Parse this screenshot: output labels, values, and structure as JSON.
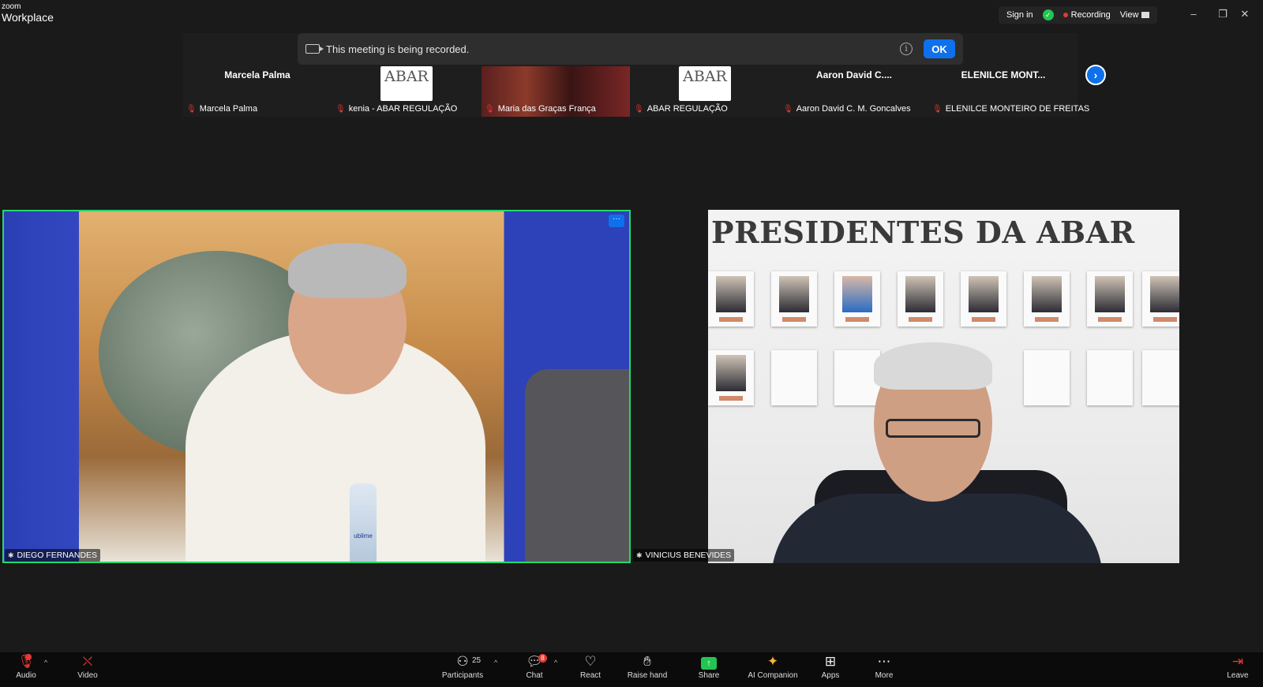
{
  "app": {
    "logo_line1": "zoom",
    "logo_line2": "Workplace"
  },
  "titlebar": {
    "sign_in": "Sign in",
    "recording": "Recording",
    "view": "View"
  },
  "banner": {
    "message": "This meeting is being recorded.",
    "ok": "OK"
  },
  "filmstrip": {
    "tiles": [
      {
        "display_name": "Marcela Palma",
        "label": "Marcela Palma"
      },
      {
        "logo_text": "ABAR",
        "label": "kenia - ABAR REGULAÇÃO"
      },
      {
        "label": "Maria das Graças França"
      },
      {
        "logo_text": "ABAR",
        "label": "ABAR REGULAÇÃO"
      },
      {
        "display_name": "Aaron David C....",
        "label": "Aaron David C. M. Goncalves"
      },
      {
        "display_name": "ELENILCE MONT...",
        "label": "ELENILCE MONTEIRO DE FREITAS"
      }
    ]
  },
  "videos": {
    "speaker": {
      "label": "DIEGO FERNANDES",
      "bottle_text": "ublime"
    },
    "guest": {
      "label": "VINICIUS BENEVIDES",
      "wall_text": "PRESIDENTES DA ABAR"
    }
  },
  "toolbar": {
    "audio": "Audio",
    "video": "Video",
    "participants": "Participants",
    "participants_count": "25",
    "chat": "Chat",
    "chat_badge": "8",
    "react": "React",
    "raise_hand": "Raise hand",
    "share": "Share",
    "ai_companion": "AI Companion",
    "apps": "Apps",
    "more": "More",
    "leave": "Leave"
  },
  "colors": {
    "accent_blue": "#0e71eb",
    "active_speaker_border": "#23d96b",
    "recording_red": "#e53935",
    "secure_green": "#23c552"
  }
}
